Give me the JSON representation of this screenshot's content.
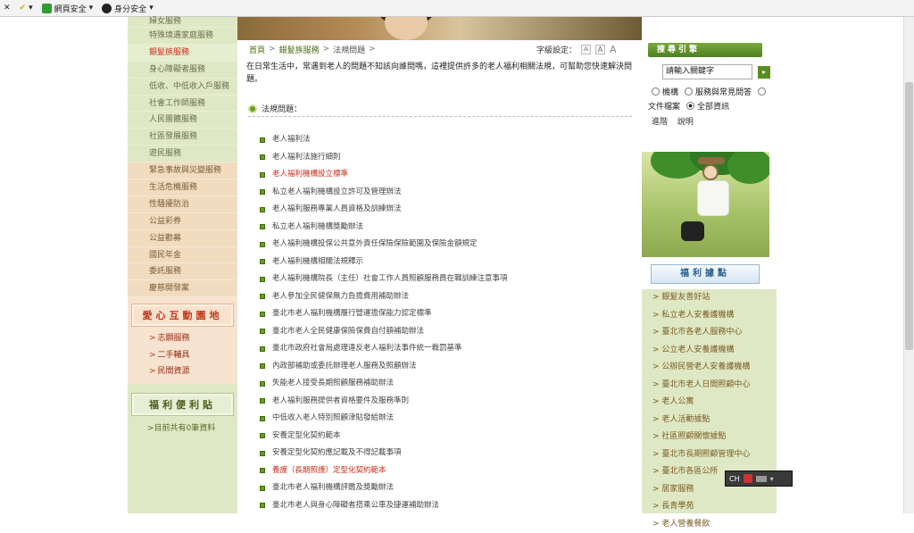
{
  "toolbar": {
    "web_safety_label": "網頁安全",
    "identity_safety_label": "身分安全"
  },
  "leftnav": {
    "items": [
      "婦女服務",
      "特殊境遇家庭服務",
      "銀髮族服務",
      "身心障礙者服務",
      "低收、中低收入戶服務",
      "社會工作師服務",
      "人民團體服務",
      "社區發展服務",
      "遊民服務",
      "緊急事故與災變服務",
      "生活危機服務",
      "性騷擾防治",
      "公益彩券",
      "公益勸募",
      "國民年金",
      "委託服務",
      "慶慈開發案"
    ],
    "active_item": "銀髮族服務",
    "interactive_box_title": "愛心互動園地",
    "interactive_links": [
      "志願服務",
      "二手輔具",
      "民間資源"
    ],
    "welfare_box_title": "福利便利貼",
    "count_text": ">目前共有0筆資料"
  },
  "breadcrumb": {
    "home": "首頁",
    "section": "銀髮族服務",
    "current": "法規問題",
    "separator": ">"
  },
  "fontsize": {
    "label": "字級設定：",
    "small": "A",
    "medium": "A",
    "large": "A"
  },
  "intro_text": "在日常生活中，常遇到老人的問題不知該向誰問嗎，這裡提供許多的老人福利相關法規，可幫助您快速解決問題。",
  "laws_heading": "法規問題：",
  "laws": [
    {
      "text": "老人福利法",
      "highlight": false
    },
    {
      "text": "老人福利法施行細則",
      "highlight": false
    },
    {
      "text": "老人福利機構設立標準",
      "highlight": true
    },
    {
      "text": "私立老人福利機構設立許可及管理辦法",
      "highlight": false
    },
    {
      "text": "老人福利服務專業人員資格及訓練辦法",
      "highlight": false
    },
    {
      "text": "私立老人福利機構獎勵辦法",
      "highlight": false
    },
    {
      "text": "老人福利機構投保公共意外責任保險保險範圍及保險金額規定",
      "highlight": false
    },
    {
      "text": "老人福利機構相關法規釋示",
      "highlight": false
    },
    {
      "text": "老人福利機構院長（主任）社會工作人員照顧服務員在職訓練注意事項",
      "highlight": false
    },
    {
      "text": "老人參加全民健保無力負擔費用補助辦法",
      "highlight": false
    },
    {
      "text": "臺北市老人福利機構履行營運擔保能力認定標準",
      "highlight": false
    },
    {
      "text": "臺北市老人全民健康保險保費自付額補助辦法",
      "highlight": false
    },
    {
      "text": "臺北市政府社會局處理違反老人福利法事件統一裁罰基準",
      "highlight": false
    },
    {
      "text": "內政部補助或委託辦理老人服務及照顧辦法",
      "highlight": false
    },
    {
      "text": "失能老人接受長期照顧服務補助辦法",
      "highlight": false
    },
    {
      "text": "老人福利服務提供者資格要件及服務準則",
      "highlight": false
    },
    {
      "text": "中低收入老人特別照顧津貼發給辦法",
      "highlight": false
    },
    {
      "text": "安養定型化契約範本",
      "highlight": false
    },
    {
      "text": "安養定型化契約應記載及不得記載事項",
      "highlight": false
    },
    {
      "text": "養護（長期照護）定型化契約範本",
      "highlight": true
    },
    {
      "text": "臺北市老人福利機構評鑑及獎勵辦法",
      "highlight": false
    },
    {
      "text": "臺北市老人與身心障礙者搭乘公車及捷運補助辦法",
      "highlight": false
    }
  ],
  "search": {
    "title": "搜尋引擎",
    "input_value": "請輸入關鍵字",
    "go_label": "▸",
    "radio_institution": "機構",
    "radio_service": "服務與常見問答",
    "radio_docs": "文件檔案",
    "radio_all": "全部資訊",
    "advanced": "進階",
    "help": "說明"
  },
  "welfare_points": {
    "title": "福利據點",
    "items": [
      "銀髮友善好站",
      "私立老人安養護機構",
      "臺北市各老人服務中心",
      "公立老人安養護機構",
      "公辦民營老人安養護機構",
      "臺北市老人日間照顧中心",
      "老人公寓",
      "老人活動據點",
      "社區照顧關懷據點",
      "臺北市長期照顧管理中心",
      "臺北市各區公所",
      "居家服務",
      "長青學苑",
      "老人營養餐飲"
    ]
  },
  "ime": {
    "label": "CH"
  }
}
